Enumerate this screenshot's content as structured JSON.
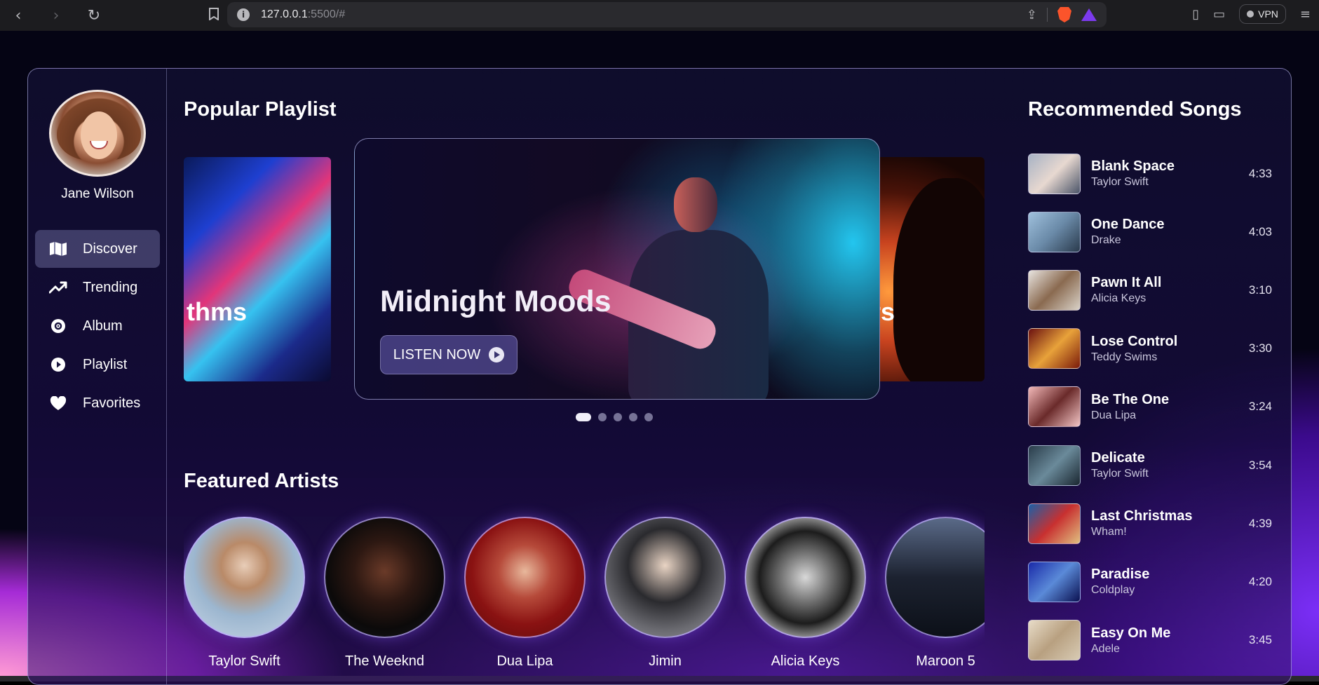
{
  "browser": {
    "url_host": "127.0.0.1",
    "url_path": ":5500/#",
    "vpn_label": "VPN"
  },
  "sidebar": {
    "username": "Jane Wilson",
    "items": [
      {
        "label": "Discover",
        "icon": "map-icon",
        "active": true
      },
      {
        "label": "Trending",
        "icon": "trending-icon",
        "active": false
      },
      {
        "label": "Album",
        "icon": "disc-icon",
        "active": false
      },
      {
        "label": "Playlist",
        "icon": "play-circle-icon",
        "active": false
      },
      {
        "label": "Favorites",
        "icon": "heart-icon",
        "active": false
      }
    ]
  },
  "main": {
    "popular_title": "Popular Playlist",
    "carousel": {
      "left_partial_title": "thms",
      "center_title": "Midnight Moods",
      "right_partial_title": "arters",
      "listen_label": "LISTEN NOW",
      "dot_count": 5,
      "active_dot": 0
    },
    "featured_title": "Featured Artists",
    "artists": [
      "Taylor Swift",
      "The Weeknd",
      "Dua Lipa",
      "Jimin",
      "Alicia Keys",
      "Maroon 5"
    ]
  },
  "recommended": {
    "title": "Recommended Songs",
    "songs": [
      {
        "title": "Blank Space",
        "artist": "Taylor Swift",
        "duration": "4:33"
      },
      {
        "title": "One Dance",
        "artist": "Drake",
        "duration": "4:03"
      },
      {
        "title": "Pawn It All",
        "artist": "Alicia Keys",
        "duration": "3:10"
      },
      {
        "title": "Lose Control",
        "artist": "Teddy Swims",
        "duration": "3:30"
      },
      {
        "title": "Be The One",
        "artist": "Dua Lipa",
        "duration": "3:24"
      },
      {
        "title": "Delicate",
        "artist": "Taylor Swift",
        "duration": "3:54"
      },
      {
        "title": "Last Christmas",
        "artist": "Wham!",
        "duration": "4:39"
      },
      {
        "title": "Paradise",
        "artist": "Coldplay",
        "duration": "4:20"
      },
      {
        "title": "Easy On Me",
        "artist": "Adele",
        "duration": "3:45"
      }
    ]
  },
  "colors": {
    "accent": "#7b2ff7",
    "panel_border": "#c8c8ff"
  }
}
